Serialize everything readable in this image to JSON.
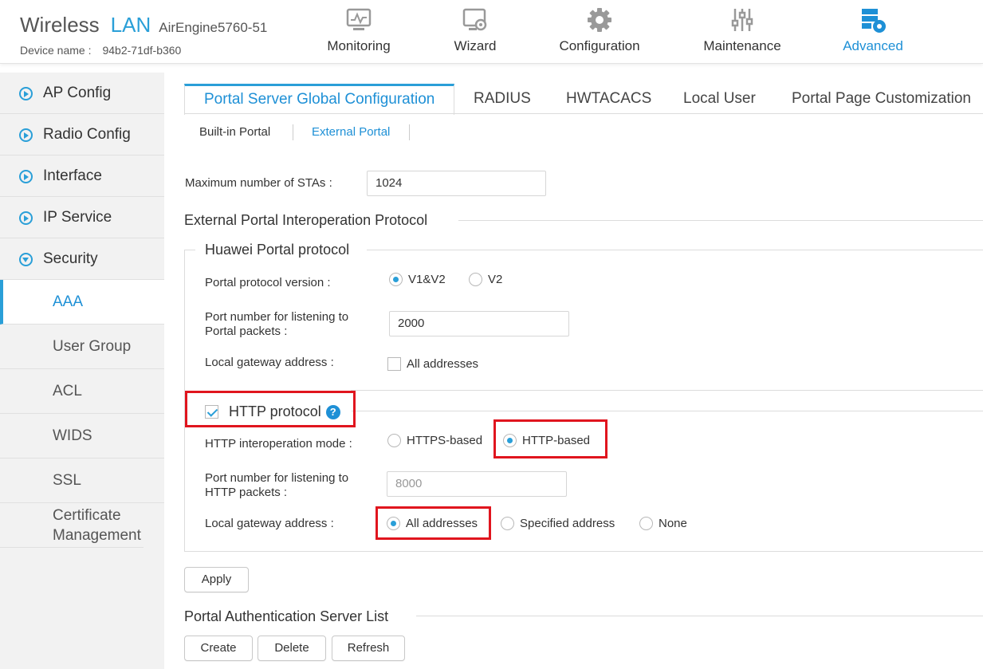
{
  "header": {
    "brand_left": "Wireless",
    "brand_right": "LAN",
    "model": "AirEngine5760-51",
    "device_label": "Device name :",
    "device_value": "94b2-71df-b360",
    "nav": [
      {
        "label": "Monitoring",
        "icon": "monitor-icon"
      },
      {
        "label": "Wizard",
        "icon": "wizard-icon"
      },
      {
        "label": "Configuration",
        "icon": "gear-icon"
      },
      {
        "label": "Maintenance",
        "icon": "sliders-icon"
      },
      {
        "label": "Advanced",
        "icon": "advanced-icon",
        "active": true
      }
    ]
  },
  "sidebar": {
    "items": [
      {
        "label": "AP Config"
      },
      {
        "label": "Radio Config"
      },
      {
        "label": "Interface"
      },
      {
        "label": "IP Service"
      },
      {
        "label": "Security",
        "open": true
      }
    ],
    "security_sub": [
      "AAA",
      "User Group",
      "ACL",
      "WIDS",
      "SSL",
      "Certificate Management"
    ]
  },
  "tabs": [
    "Portal Server Global Configuration",
    "RADIUS",
    "HWTACACS",
    "Local User",
    "Portal Page Customization"
  ],
  "subtabs": [
    "Built-in Portal",
    "External Portal"
  ],
  "form": {
    "max_sta_label": "Maximum number of STAs :",
    "max_sta_value": "1024",
    "interop_title": "External Portal Interoperation Protocol",
    "huawei": {
      "title": "Huawei Portal protocol",
      "version_label": "Portal protocol version :",
      "version_options": [
        "V1&V2",
        "V2"
      ],
      "port_label_1": "Port number for listening to",
      "port_label_2": "Portal packets :",
      "port_value": "2000",
      "gateway_label": "Local gateway address :",
      "gateway_option": "All addresses"
    },
    "http": {
      "title": "HTTP protocol",
      "help": "?",
      "mode_label": "HTTP interoperation mode :",
      "mode_options": [
        "HTTPS-based",
        "HTTP-based"
      ],
      "port_label_1": "Port number for listening to",
      "port_label_2": "HTTP packets :",
      "port_value": "8000",
      "gateway_label": "Local gateway address :",
      "gateway_options": [
        "All addresses",
        "Specified address",
        "None"
      ]
    },
    "apply": "Apply",
    "server_list_title": "Portal Authentication Server List",
    "buttons": [
      "Create",
      "Delete",
      "Refresh"
    ]
  },
  "colors": {
    "accent": "#2a9fd8",
    "highlight": "#e0151e"
  }
}
